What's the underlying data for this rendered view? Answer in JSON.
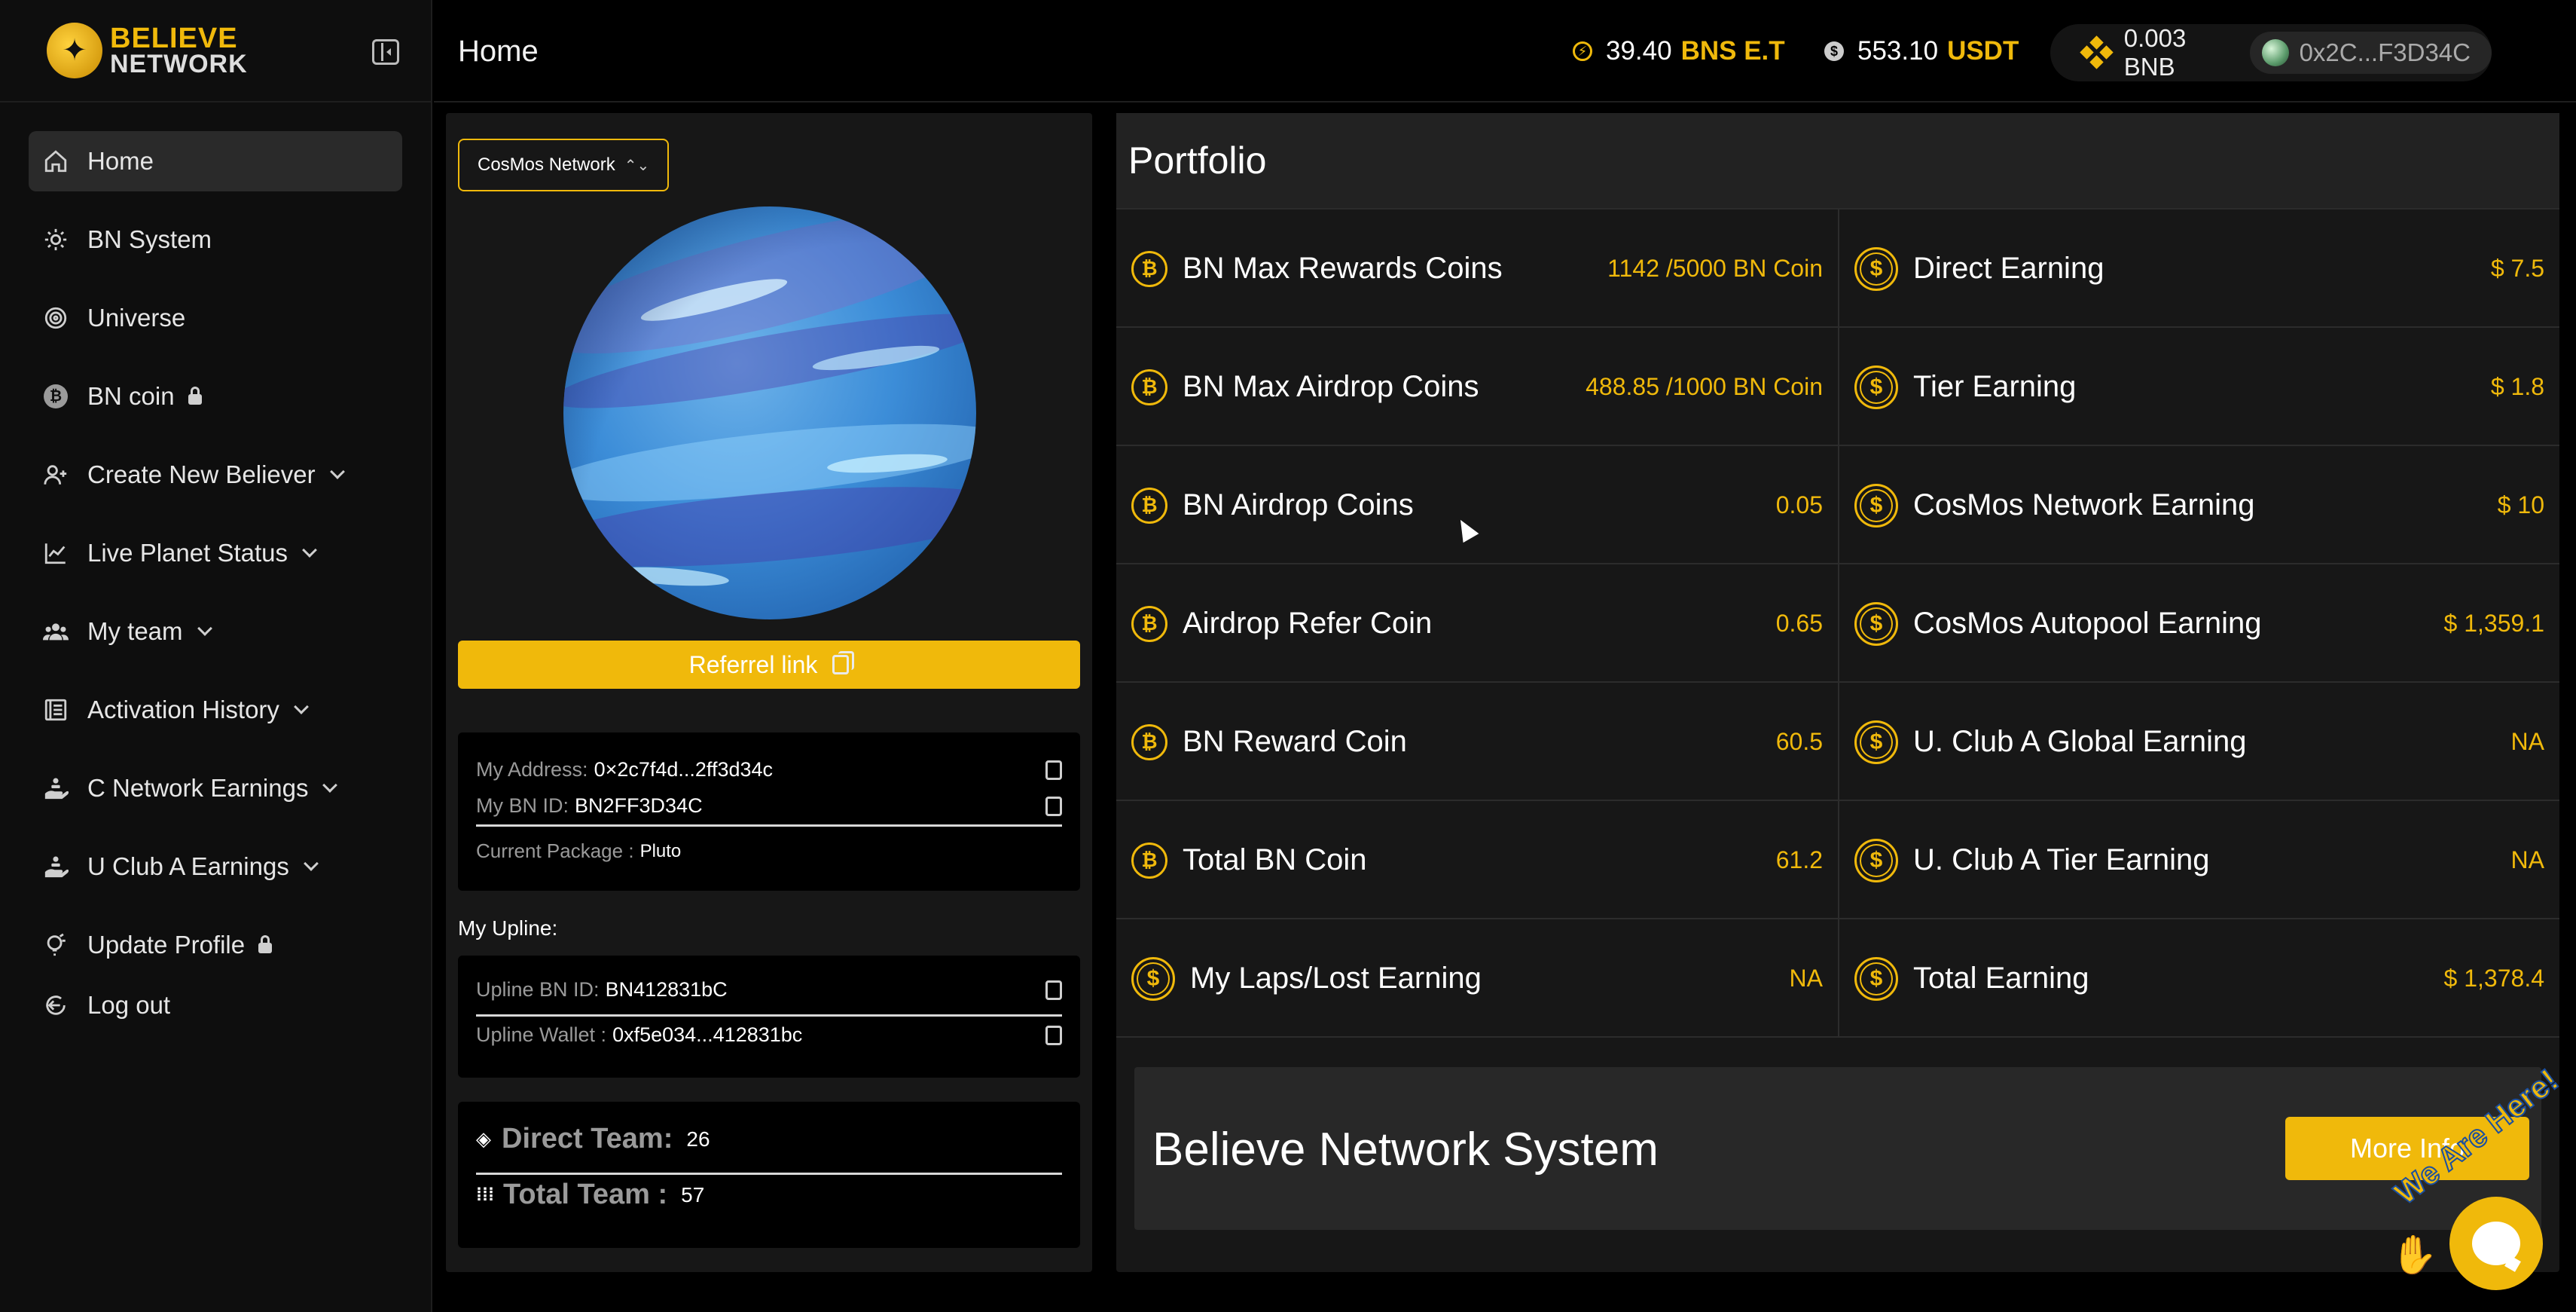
{
  "app": {
    "logo_line1": "BELIEVE",
    "logo_line2": "NETWORK"
  },
  "header": {
    "title": "Home",
    "bns_value": "39.40",
    "bns_unit": "BNS E.T",
    "usdt_value": "553.10",
    "usdt_unit": "USDT",
    "bnb_balance": "0.003 BNB",
    "wallet_short": "0x2C...F3D34C"
  },
  "sidebar": {
    "items": [
      {
        "label": "Home",
        "icon": "home-icon",
        "active": true
      },
      {
        "label": "BN System",
        "icon": "sun-icon"
      },
      {
        "label": "Universe",
        "icon": "galaxy-icon"
      },
      {
        "label": "BN coin",
        "icon": "bitcoin-icon",
        "locked": true
      },
      {
        "label": "Create New Believer",
        "icon": "user-add-icon",
        "expandable": true
      },
      {
        "label": "Live Planet Status",
        "icon": "chart-line-icon",
        "expandable": true
      },
      {
        "label": "My team",
        "icon": "team-icon",
        "expandable": true
      },
      {
        "label": "Activation History",
        "icon": "list-icon",
        "expandable": true
      },
      {
        "label": "C Network Earnings",
        "icon": "earnings-hand-icon",
        "expandable": true
      },
      {
        "label": "U Club A Earnings",
        "icon": "earnings-hand-icon",
        "expandable": true
      },
      {
        "label": "Update Profile",
        "icon": "bulb-icon",
        "locked": true
      },
      {
        "label": "Log out",
        "icon": "logout-icon"
      }
    ]
  },
  "left_panel": {
    "network_select": "CosMos Network",
    "referral_label": "Referrel link",
    "my_address_label": "My Address:",
    "my_address": "0×2c7f4d...2ff3d34c",
    "my_bn_id_label": "My BN ID:",
    "my_bn_id": "BN2FF3D34C",
    "package_label": "Current Package :",
    "package": "Pluto",
    "upline_heading": "My Upline:",
    "upline_id_label": "Upline BN ID:",
    "upline_id": "BN412831bC",
    "upline_wallet_label": "Upline Wallet :",
    "upline_wallet": "0xf5e034...412831bc",
    "direct_team_label": "Direct Team:",
    "direct_team": "26",
    "total_team_label": "Total Team :",
    "total_team": "57"
  },
  "portfolio": {
    "title": "Portfolio",
    "left": [
      {
        "label": "BN Max Rewards Coins",
        "value": "1142 /5000 BN Coin"
      },
      {
        "label": "BN Max Airdrop Coins",
        "value": "488.85 /1000 BN Coin"
      },
      {
        "label": "BN Airdrop Coins",
        "value": "0.05"
      },
      {
        "label": "Airdrop Refer Coin",
        "value": "0.65"
      },
      {
        "label": "BN Reward Coin",
        "value": "60.5"
      },
      {
        "label": "Total BN Coin",
        "value": "61.2"
      },
      {
        "label": "My Laps/Lost Earning",
        "value": "NA"
      }
    ],
    "right": [
      {
        "label": "Direct Earning",
        "value": "$ 7.5"
      },
      {
        "label": "Tier Earning",
        "value": "$ 1.8"
      },
      {
        "label": "CosMos Network Earning",
        "value": "$ 10"
      },
      {
        "label": "CosMos Autopool Earning",
        "value": "$ 1,359.1"
      },
      {
        "label": "U. Club A Global Earning",
        "value": "NA"
      },
      {
        "label": "U. Club A Tier Earning",
        "value": "NA"
      },
      {
        "label": "Total Earning",
        "value": "$ 1,378.4"
      }
    ]
  },
  "system_card": {
    "title": "Believe Network System",
    "button": "More Info"
  },
  "chat": {
    "text": "We Are Here!"
  }
}
